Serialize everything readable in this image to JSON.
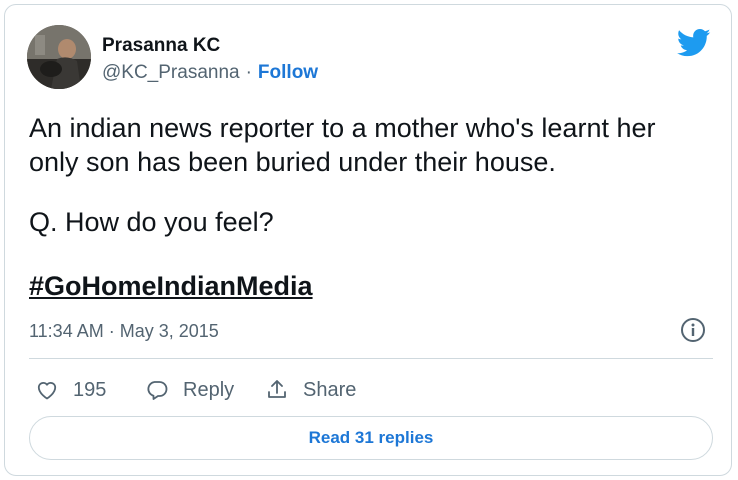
{
  "author": {
    "name": "Prasanna KC",
    "handle": "@KC_Prasanna",
    "separator": "·",
    "follow_label": "Follow"
  },
  "tweet": {
    "paragraphs": [
      "An indian news reporter to a mother who's learnt her only son has been buried under their house.",
      "Q. How do you feel?"
    ],
    "hashtag": "#GoHomeIndianMedia",
    "timestamp": "11:34 AM · May 3, 2015"
  },
  "actions": {
    "like_count": "195",
    "reply_label": "Reply",
    "share_label": "Share"
  },
  "read_replies_label": "Read 31 replies",
  "colors": {
    "twitter_blue": "#1d9bf0",
    "link_blue": "#1d77d6",
    "text": "#0f1419",
    "secondary": "#536471",
    "border": "#cfd9de"
  },
  "icons": {
    "brand": "twitter-bird-icon",
    "info": "info-icon",
    "like": "heart-icon",
    "reply": "speech-bubble-icon",
    "share": "share-upload-icon"
  }
}
